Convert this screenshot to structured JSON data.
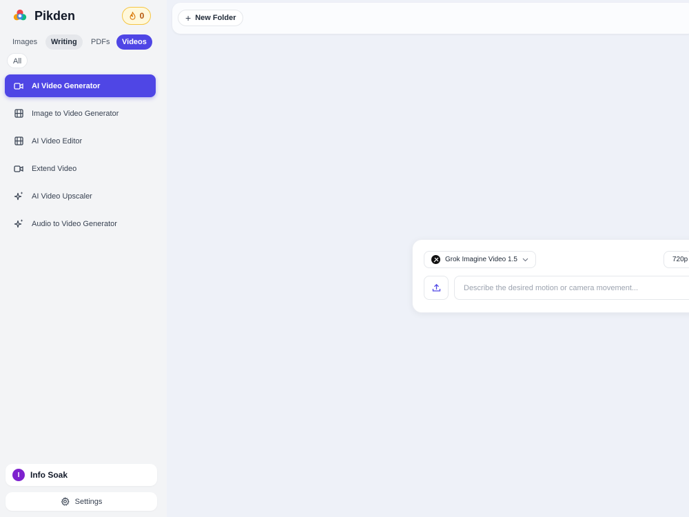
{
  "brand": {
    "name": "Pikden"
  },
  "credits": {
    "count": "0"
  },
  "categories": [
    {
      "label": "Images"
    },
    {
      "label": "Writing"
    },
    {
      "label": "PDFs"
    },
    {
      "label": "Videos"
    },
    {
      "label": "All"
    }
  ],
  "nav": [
    {
      "label": "AI Video Generator",
      "icon": "video-camera-icon",
      "active": true
    },
    {
      "label": "Image to Video Generator",
      "icon": "film-icon"
    },
    {
      "label": "AI Video Editor",
      "icon": "film-icon"
    },
    {
      "label": "Extend Video",
      "icon": "video-camera-icon"
    },
    {
      "label": "AI Video Upscaler",
      "icon": "sparkles-icon"
    },
    {
      "label": "Audio to Video Generator",
      "icon": "sparkles-icon"
    }
  ],
  "user": {
    "initial": "I",
    "name": "Info Soak"
  },
  "settings": {
    "label": "Settings"
  },
  "toolbar": {
    "new_folder_label": "New Folder"
  },
  "composer": {
    "model": "Grok Imagine Video 1.5",
    "resolution": "720p",
    "prompt_placeholder": "Describe the desired motion or camera movement..."
  },
  "colors": {
    "accent": "#4f46e5",
    "avatar": "#7e22ce",
    "credits_border": "#f5c542"
  }
}
